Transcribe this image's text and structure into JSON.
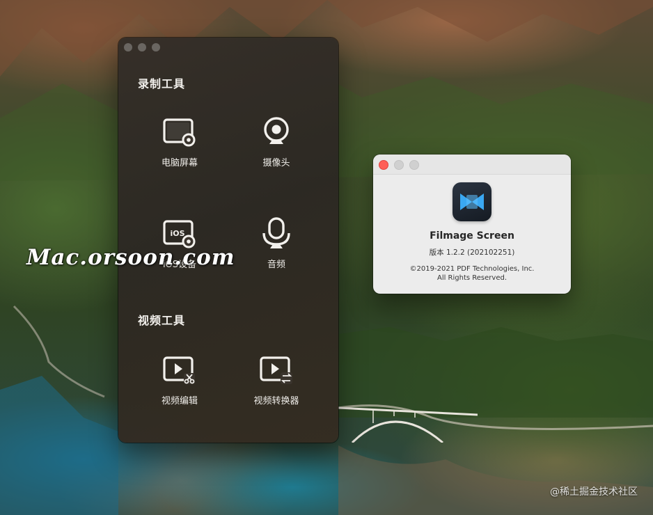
{
  "tools_window": {
    "record_section_title": "录制工具",
    "record_tools": [
      {
        "label": "电脑屏幕",
        "icon": "screen-record-icon"
      },
      {
        "label": "摄像头",
        "icon": "webcam-icon"
      },
      {
        "label": "iOS设备",
        "icon": "ios-device-icon",
        "icon_text": "iOS"
      },
      {
        "label": "音频",
        "icon": "microphone-icon"
      }
    ],
    "video_section_title": "视频工具",
    "video_tools": [
      {
        "label": "视频编辑",
        "icon": "video-edit-icon"
      },
      {
        "label": "视频转换器",
        "icon": "video-convert-icon"
      }
    ]
  },
  "about_window": {
    "app_name": "Filmage Screen",
    "version": "版本 1.2.2 (202102251)",
    "copyright_line1": "©2019-2021 PDF Technologies, Inc.",
    "copyright_line2": "All Rights Reserved.",
    "icon": "filmage-app-icon",
    "colors": {
      "close": "#fe5f57",
      "icon_accent": "#3aa8f2"
    }
  },
  "overlay": {
    "watermark": "Mac.orsoon.com",
    "credit": "@稀土掘金技术社区"
  }
}
